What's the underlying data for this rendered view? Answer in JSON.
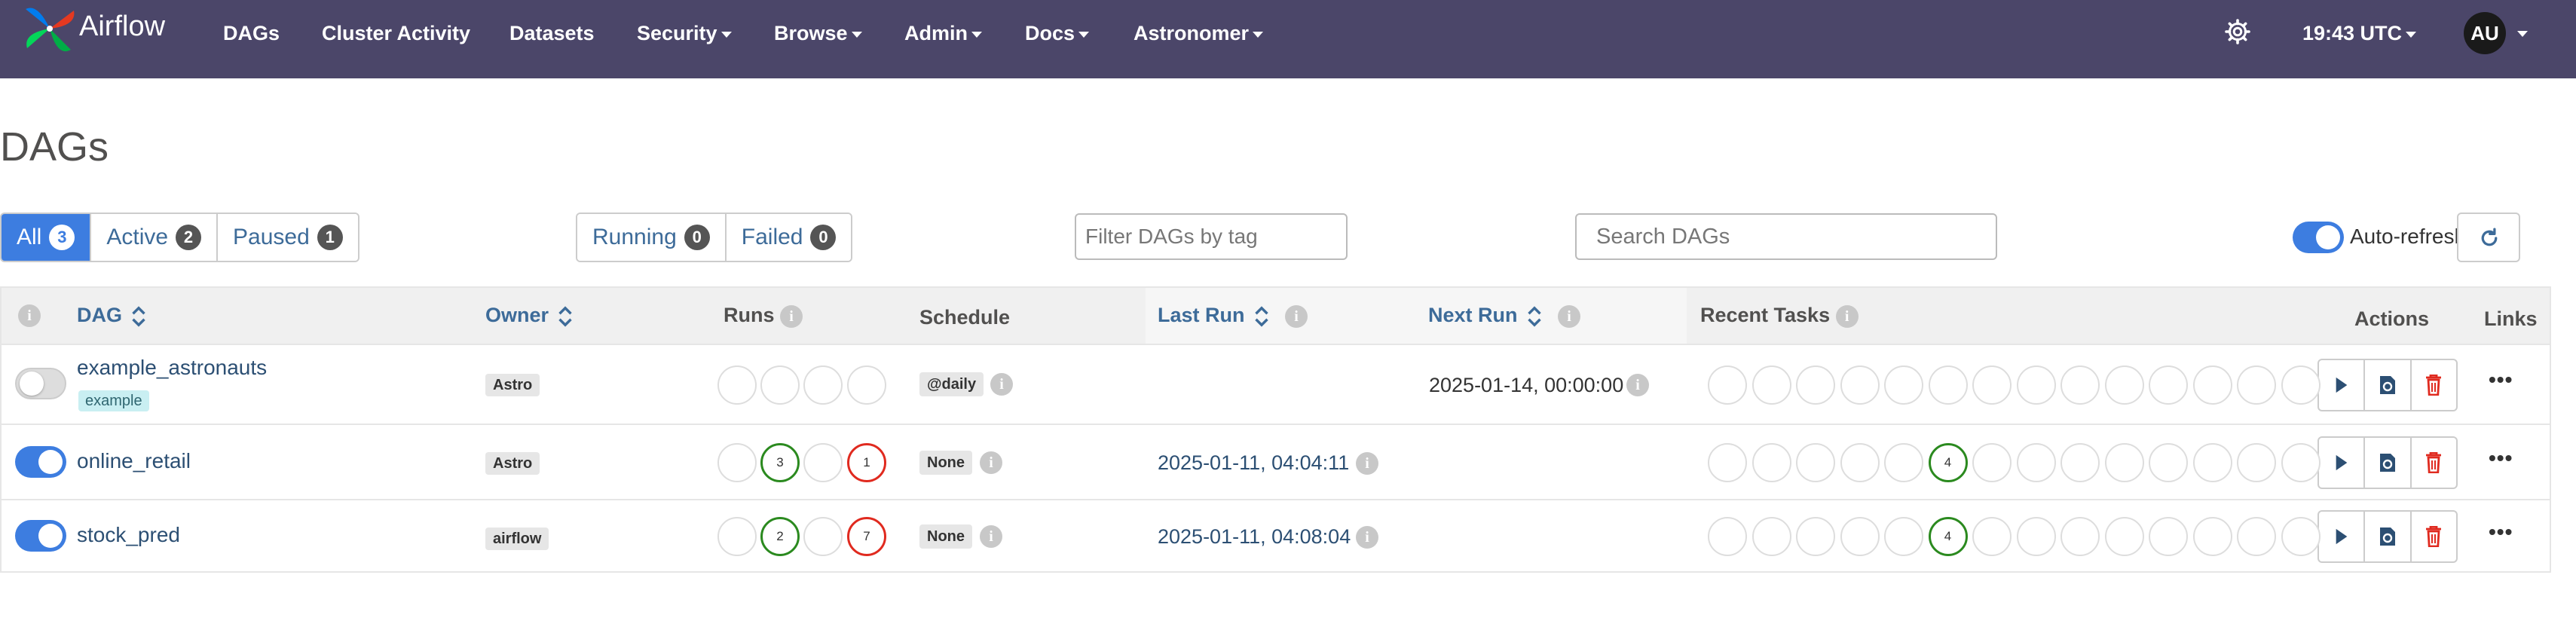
{
  "brand": {
    "name": "Airflow"
  },
  "nav": {
    "items": [
      {
        "label": "DAGs"
      },
      {
        "label": "Cluster Activity"
      },
      {
        "label": "Datasets"
      },
      {
        "label": "Security"
      },
      {
        "label": "Browse"
      },
      {
        "label": "Admin"
      },
      {
        "label": "Docs"
      },
      {
        "label": "Astronomer"
      }
    ],
    "time": "19:43 UTC",
    "user_initials": "AU"
  },
  "page": {
    "title": "DAGs"
  },
  "filters": {
    "status": [
      {
        "label": "All",
        "count": "3"
      },
      {
        "label": "Active",
        "count": "2"
      },
      {
        "label": "Paused",
        "count": "1"
      }
    ],
    "run_state": [
      {
        "label": "Running",
        "count": "0"
      },
      {
        "label": "Failed",
        "count": "0"
      }
    ],
    "tag_placeholder": "Filter DAGs by tag",
    "search_placeholder": "Search DAGs",
    "auto_refresh_label": "Auto-refresh",
    "auto_refresh_on": true
  },
  "table": {
    "headers": {
      "dag": "DAG",
      "owner": "Owner",
      "runs": "Runs",
      "schedule": "Schedule",
      "last_run": "Last Run",
      "next_run": "Next Run",
      "recent_tasks": "Recent Tasks",
      "actions": "Actions",
      "links": "Links"
    },
    "rows": [
      {
        "active": false,
        "dag_id": "example_astronauts",
        "tag": "example",
        "owner": "Astro",
        "runs": [
          "",
          "",
          "",
          ""
        ],
        "schedule": "@daily",
        "last_run": "",
        "next_run": "2025-01-14, 00:00:00",
        "recent_tasks_nonzero": []
      },
      {
        "active": true,
        "dag_id": "online_retail",
        "tag": "",
        "owner": "Astro",
        "runs": [
          "",
          "3",
          "",
          "1"
        ],
        "schedule": "None",
        "last_run": "2025-01-11, 04:04:11",
        "next_run": "",
        "recent_tasks_nonzero": [
          {
            "index": 5,
            "value": "4"
          }
        ]
      },
      {
        "active": true,
        "dag_id": "stock_pred",
        "tag": "",
        "owner": "airflow",
        "runs": [
          "",
          "2",
          "",
          "7"
        ],
        "schedule": "None",
        "last_run": "2025-01-11, 04:08:04",
        "next_run": "",
        "recent_tasks_nonzero": [
          {
            "index": 5,
            "value": "4"
          }
        ]
      }
    ]
  },
  "colors": {
    "navbar": "#4b4669",
    "primary": "#3d7de0",
    "success": "#2b8a1f",
    "failed": "#e02a1f",
    "link": "#2c4f73"
  }
}
